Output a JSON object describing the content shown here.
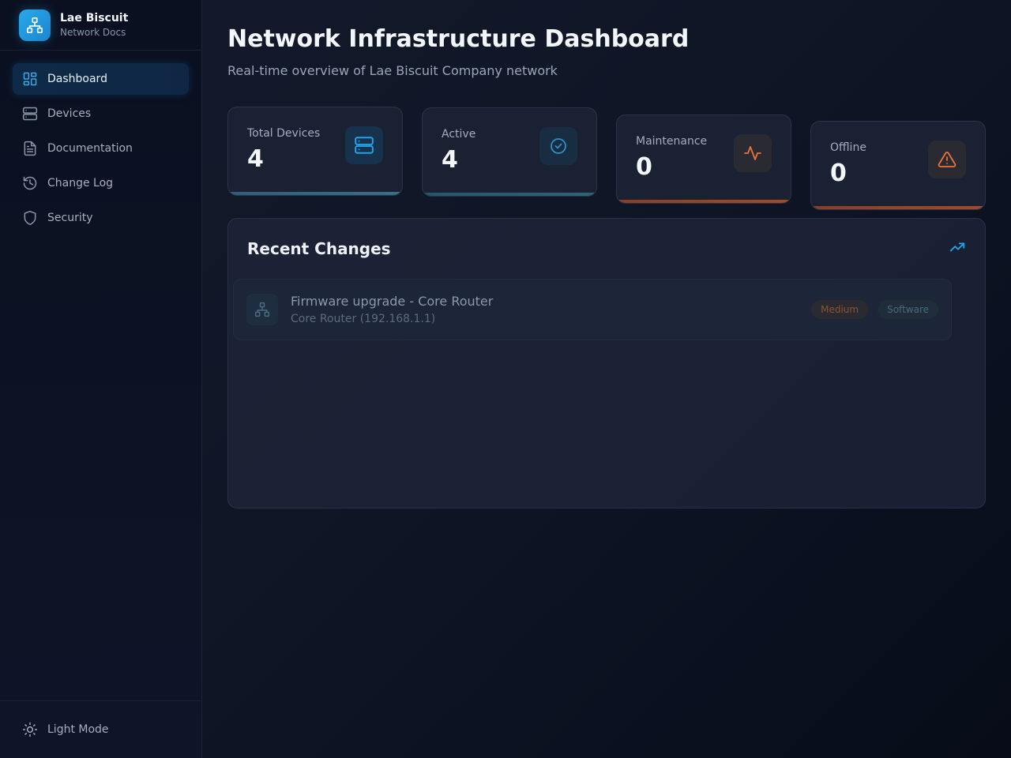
{
  "sidebar": {
    "brand": {
      "name": "Lae Biscuit",
      "subtitle": "Network Docs"
    },
    "items": [
      {
        "label": "Dashboard",
        "icon": "layout-grid-icon",
        "active": true
      },
      {
        "label": "Devices",
        "icon": "server-icon",
        "active": false
      },
      {
        "label": "Documentation",
        "icon": "file-text-icon",
        "active": false
      },
      {
        "label": "Change Log",
        "icon": "history-icon",
        "active": false
      },
      {
        "label": "Security",
        "icon": "shield-icon",
        "active": false
      }
    ],
    "footer": {
      "label": "Light Mode",
      "icon": "sun-icon"
    }
  },
  "header": {
    "title": "Network Infrastructure Dashboard",
    "subtitle": "Real-time overview of Lae Biscuit Company network"
  },
  "stats": [
    {
      "label": "Total Devices",
      "value": "4",
      "icon": "server-icon",
      "accent": "#22a3e6"
    },
    {
      "label": "Active",
      "value": "4",
      "icon": "check-circle-icon",
      "accent": "#2f8fc4"
    },
    {
      "label": "Maintenance",
      "value": "0",
      "icon": "activity-icon",
      "accent": "#e9733a"
    },
    {
      "label": "Offline",
      "value": "0",
      "icon": "alert-triangle-icon",
      "accent": "#e9733a"
    }
  ],
  "recent_changes": {
    "title": "Recent Changes",
    "icon": "trending-up-icon",
    "items": [
      {
        "title": "Firmware upgrade - Core Router",
        "device": "Core Router (192.168.1.1)",
        "icon": "network-icon",
        "priority": "Medium",
        "category": "Software"
      }
    ]
  },
  "colors": {
    "accent": "#22a3e6",
    "warning": "#e9733a",
    "background": "#0f1626",
    "card": "#1a2133"
  }
}
